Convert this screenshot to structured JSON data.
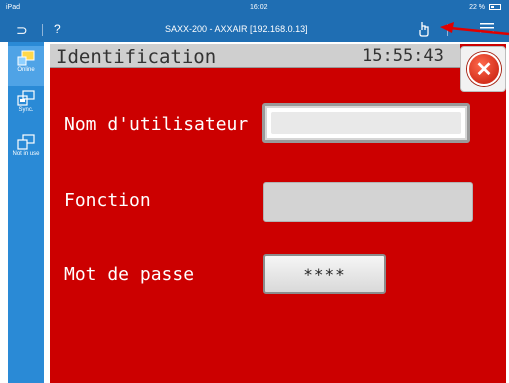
{
  "statusbar": {
    "device": "iPad",
    "time": "16:02",
    "battery": "22 %"
  },
  "appbar": {
    "back_glyph": "⊃",
    "help_glyph": "?",
    "title": "SAXX-200 - AXXAIR [192.168.0.13]",
    "tool_icon": "hand-pointer-icon",
    "menu_icon": "menu-icon"
  },
  "sidemenu": {
    "items": [
      {
        "label": "Online",
        "icon": "online-icon"
      },
      {
        "label": "Sync.",
        "icon": "sync-icon"
      },
      {
        "label": "Not in use",
        "icon": "not-in-use-icon"
      }
    ]
  },
  "screen": {
    "title": "Identification",
    "clock": "15:55:43",
    "username_label": "Nom d'utilisateur",
    "username_value": "",
    "function_label": "Fonction",
    "function_value": "",
    "password_label": "Mot de passe",
    "password_value": "****"
  },
  "colors": {
    "panel": "#cc0000",
    "header": "#1f6eb3",
    "sidemenu": "#2a8ad6",
    "annotation_arrow": "#e00000"
  }
}
